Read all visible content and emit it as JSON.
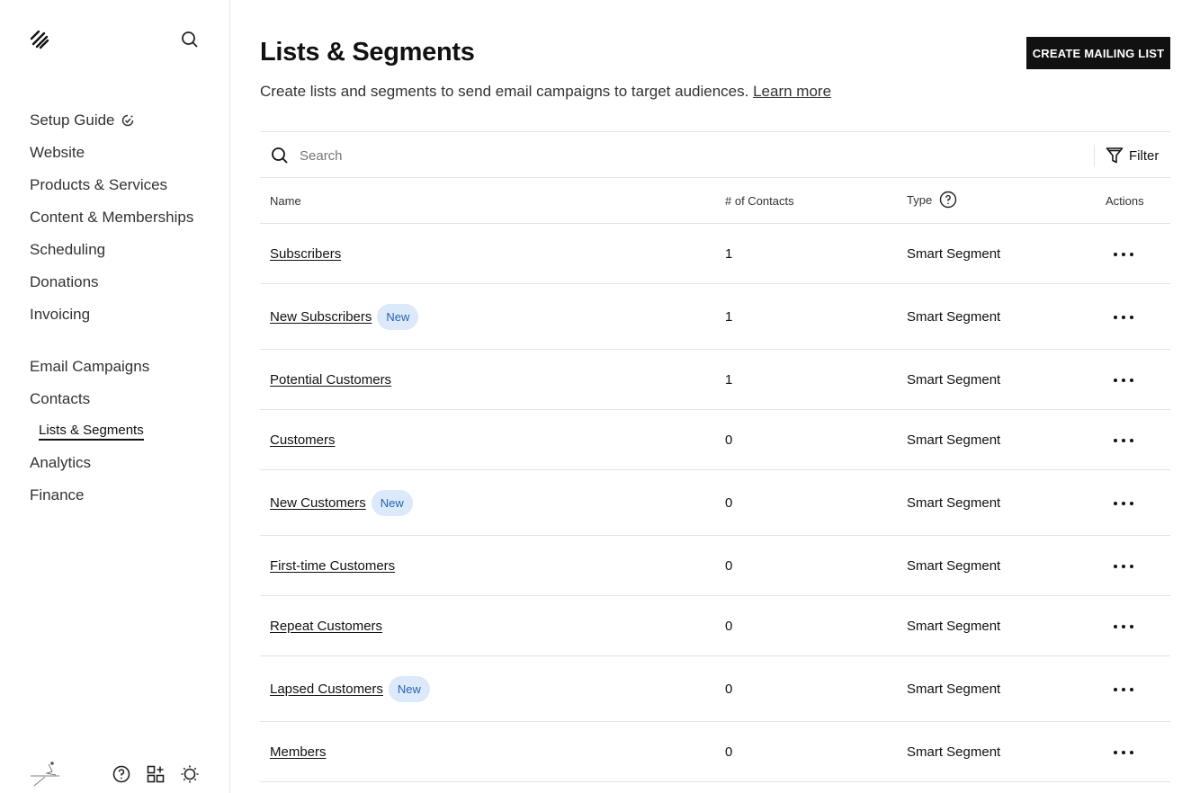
{
  "sidebar": {
    "nav": [
      {
        "label": "Setup Guide"
      },
      {
        "label": "Website"
      },
      {
        "label": "Products & Services"
      },
      {
        "label": "Content & Memberships"
      },
      {
        "label": "Scheduling"
      },
      {
        "label": "Donations"
      },
      {
        "label": "Invoicing"
      },
      {
        "label": "Email Campaigns"
      },
      {
        "label": "Contacts"
      },
      {
        "label": "Analytics"
      },
      {
        "label": "Finance"
      }
    ],
    "sub_item": {
      "label": "Lists & Segments"
    }
  },
  "header": {
    "title": "Lists & Segments",
    "description": "Create lists and segments to send email campaigns to target audiences.",
    "learn_more": "Learn more",
    "create_button": "CREATE MAILING LIST"
  },
  "search": {
    "placeholder": "Search",
    "filter_label": "Filter"
  },
  "table": {
    "columns": [
      "Name",
      "# of Contacts",
      "Type",
      "Actions"
    ],
    "rows": [
      {
        "name": "Subscribers",
        "badge": "",
        "contacts": "1",
        "type": "Smart Segment"
      },
      {
        "name": "New Subscribers",
        "badge": "New",
        "contacts": "1",
        "type": "Smart Segment"
      },
      {
        "name": "Potential Customers",
        "badge": "",
        "contacts": "1",
        "type": "Smart Segment"
      },
      {
        "name": "Customers",
        "badge": "",
        "contacts": "0",
        "type": "Smart Segment"
      },
      {
        "name": "New Customers",
        "badge": "New",
        "contacts": "0",
        "type": "Smart Segment"
      },
      {
        "name": "First-time Customers",
        "badge": "",
        "contacts": "0",
        "type": "Smart Segment"
      },
      {
        "name": "Repeat Customers",
        "badge": "",
        "contacts": "0",
        "type": "Smart Segment"
      },
      {
        "name": "Lapsed Customers",
        "badge": "New",
        "contacts": "0",
        "type": "Smart Segment"
      },
      {
        "name": "Members",
        "badge": "",
        "contacts": "0",
        "type": "Smart Segment"
      }
    ]
  },
  "colors": {
    "primary": "#111111",
    "badge_bg": "#dbe9fb",
    "badge_text": "#2a63b0",
    "divider": "#e4e4e4"
  }
}
